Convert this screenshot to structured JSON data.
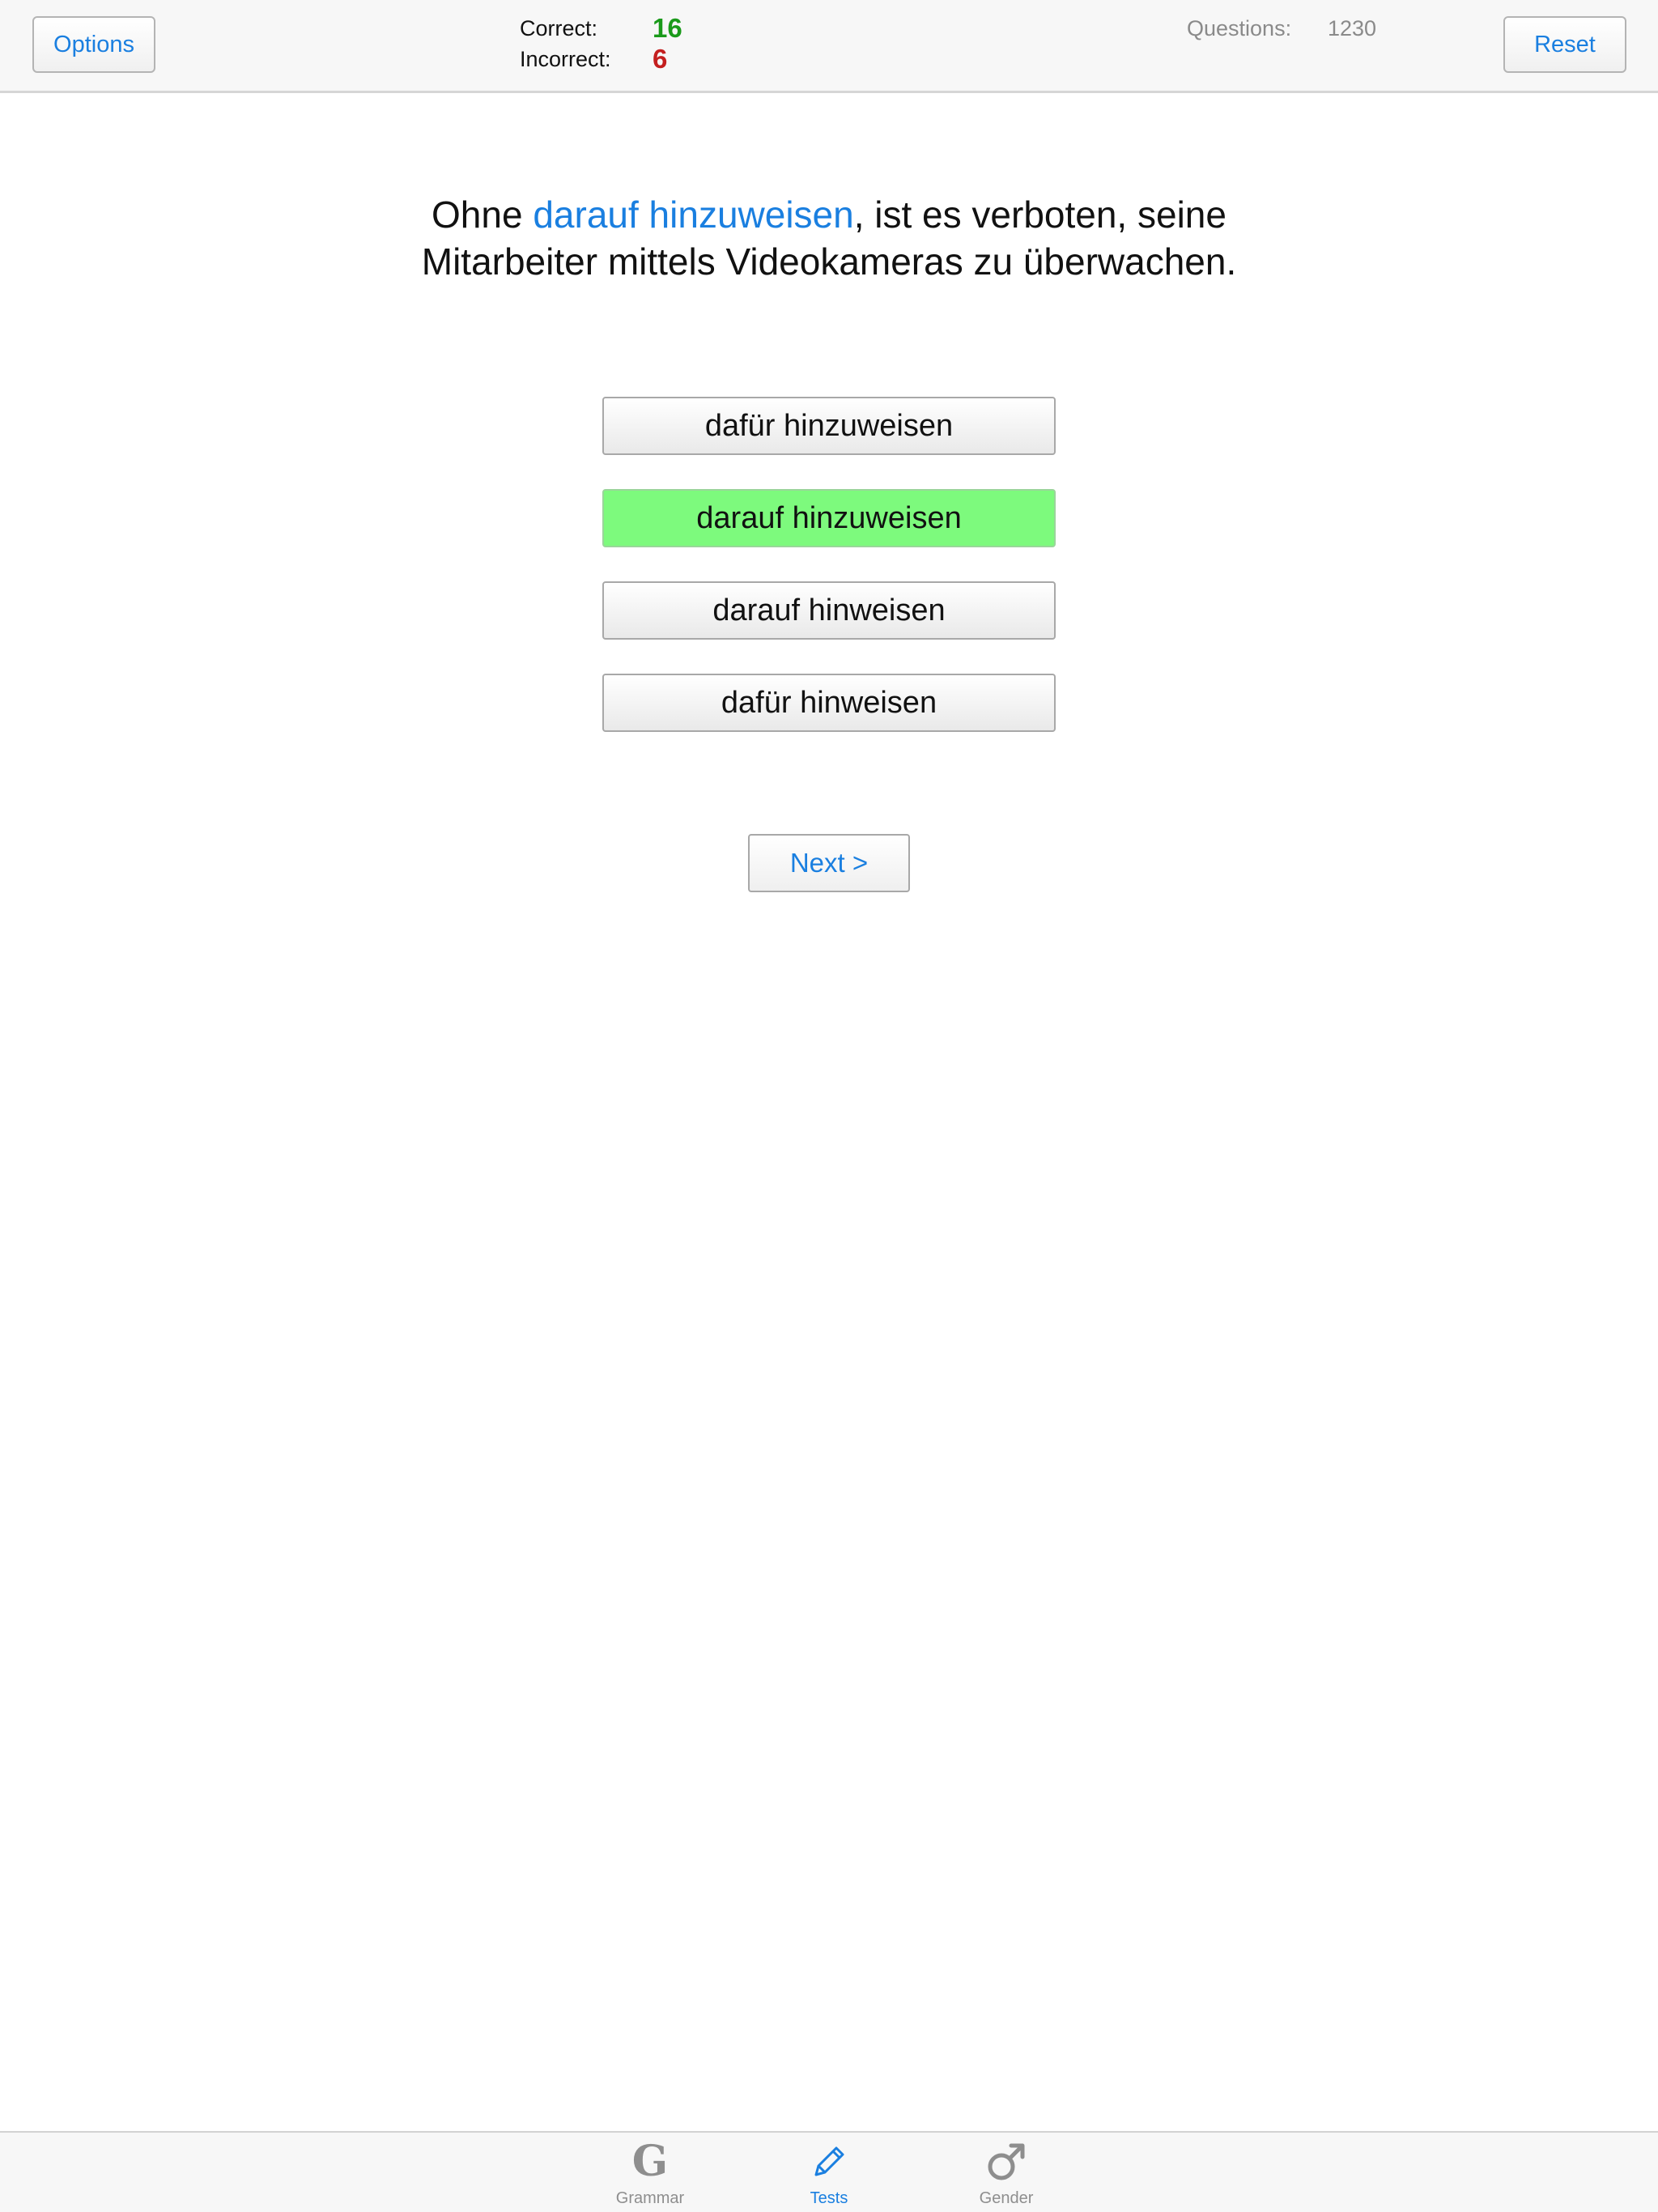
{
  "topbar": {
    "options_label": "Options",
    "reset_label": "Reset",
    "correct_label": "Correct:",
    "correct_value": "16",
    "incorrect_label": "Incorrect:",
    "incorrect_value": "6",
    "questions_label": "Questions:",
    "questions_value": "1230"
  },
  "question": {
    "line1_before": "Ohne ",
    "line1_highlight": "darauf hinzuweisen",
    "line1_after": ", ist es verboten, seine",
    "line2": "Mitarbeiter mittels Videokameras zu überwachen."
  },
  "answers": [
    {
      "label": "dafür hinzuweisen",
      "selected": false
    },
    {
      "label": "darauf hinzuweisen",
      "selected": true
    },
    {
      "label": "darauf hinweisen",
      "selected": false
    },
    {
      "label": "dafür hinweisen",
      "selected": false
    }
  ],
  "next_label": "Next >",
  "tabbar": {
    "tabs": [
      {
        "label": "Grammar",
        "icon": "grammar-g-icon",
        "glyph": "G"
      },
      {
        "label": "Tests",
        "icon": "pencil-icon",
        "active": true
      },
      {
        "label": "Gender",
        "icon": "male-symbol-icon"
      }
    ]
  },
  "colors": {
    "accent": "#1a7fe0",
    "correct": "#1a9a1a",
    "incorrect": "#c41f1f",
    "selected_answer": "#7dfa7d"
  }
}
